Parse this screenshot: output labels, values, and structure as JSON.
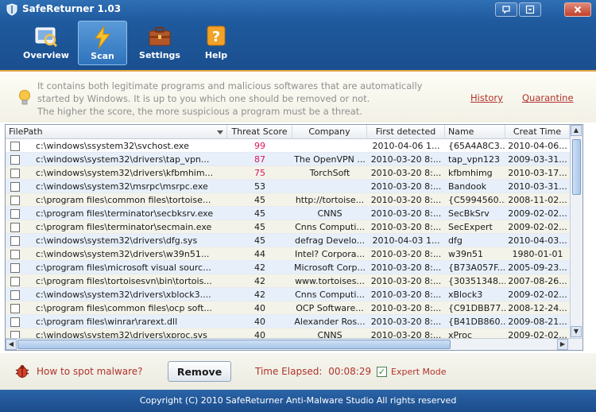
{
  "window": {
    "title": "SafeReturner 1.03",
    "controls": [
      "chat",
      "menu",
      "close"
    ]
  },
  "toolbar": {
    "items": [
      {
        "label": "Overview",
        "icon": "overview-icon"
      },
      {
        "label": "Scan",
        "icon": "scan-icon",
        "active": true
      },
      {
        "label": "Settings",
        "icon": "settings-icon"
      },
      {
        "label": "Help",
        "icon": "help-icon"
      }
    ]
  },
  "info": {
    "text_line1": "It contains both legitimate programs and malicious softwares that are automatically",
    "text_line2": "started by Windows. It is up to you which one should be removed or not.",
    "text_line3": "The higher the score, the more suspicious a program must be a threat.",
    "history_link": "History",
    "quarantine_link": "Quarantine"
  },
  "table": {
    "columns": [
      "FilePath",
      "Threat Score",
      "Company",
      "First detected",
      "Name",
      "Creat Time"
    ],
    "rows": [
      {
        "path": "c:\\windows\\ssystem32\\svchost.exe",
        "score": "99",
        "company": "",
        "first": "2010-04-06 1...",
        "name": "{65A4A8C3...",
        "created": "2010-04-06..."
      },
      {
        "path": "c:\\windows\\system32\\drivers\\tap_vpn...",
        "score": "87",
        "company": "The OpenVPN ...",
        "first": "2010-03-20 8:...",
        "name": "tap_vpn123",
        "created": "2009-03-31..."
      },
      {
        "path": "c:\\windows\\system32\\drivers\\kfbmhim...",
        "score": "75",
        "company": "TorchSoft",
        "first": "2010-03-20 8:...",
        "name": "kfbmhimg",
        "created": "2010-03-17..."
      },
      {
        "path": "c:\\windows\\system32\\msrpc\\msrpc.exe",
        "score": "53",
        "company": "",
        "first": "2010-03-20 8:...",
        "name": "Bandook",
        "created": "2010-03-31..."
      },
      {
        "path": "c:\\program files\\common files\\tortoise...",
        "score": "45",
        "company": "http://tortoise...",
        "first": "2010-03-20 8:...",
        "name": "{C5994560...",
        "created": "2008-11-02..."
      },
      {
        "path": "c:\\program files\\terminator\\secbksrv.exe",
        "score": "45",
        "company": "CNNS",
        "first": "2010-03-20 8:...",
        "name": "SecBkSrv",
        "created": "2009-02-02..."
      },
      {
        "path": "c:\\program files\\terminator\\secmain.exe",
        "score": "45",
        "company": "Cnns Computi...",
        "first": "2010-03-20 8:...",
        "name": "SecExpert",
        "created": "2009-02-02..."
      },
      {
        "path": "c:\\windows\\system32\\drivers\\dfg.sys",
        "score": "45",
        "company": "defrag Develo...",
        "first": "2010-04-03 1...",
        "name": "dfg",
        "created": "2010-04-03..."
      },
      {
        "path": "c:\\windows\\system32\\drivers\\w39n51...",
        "score": "44",
        "company": "Intel? Corpora...",
        "first": "2010-03-20 8:...",
        "name": "w39n51",
        "created": "1980-01-01"
      },
      {
        "path": "c:\\program files\\microsoft visual sourc...",
        "score": "42",
        "company": "Microsoft Corp...",
        "first": "2010-03-20 8:...",
        "name": "{B73A057F...",
        "created": "2005-09-23..."
      },
      {
        "path": "c:\\program files\\tortoisesvn\\bin\\tortois...",
        "score": "42",
        "company": "www.tortoises...",
        "first": "2010-03-20 8:...",
        "name": "{30351348...",
        "created": "2007-08-26..."
      },
      {
        "path": "c:\\windows\\system32\\drivers\\xblock3....",
        "score": "42",
        "company": "Cnns Computi...",
        "first": "2010-03-20 8:...",
        "name": "xBlock3",
        "created": "2009-02-02..."
      },
      {
        "path": "c:\\program files\\common files\\ocp soft...",
        "score": "40",
        "company": "OCP Software...",
        "first": "2010-03-20 8:...",
        "name": "{C91DBB77...",
        "created": "2008-12-24..."
      },
      {
        "path": "c:\\program files\\winrar\\rarext.dll",
        "score": "40",
        "company": "Alexander Ros...",
        "first": "2010-03-20 8:...",
        "name": "{B41DB860...",
        "created": "2009-08-21..."
      },
      {
        "path": "c:\\windows\\system32\\drivers\\xproc.sys",
        "score": "40",
        "company": "CNNS",
        "first": "2010-03-20 8:...",
        "name": "xProc",
        "created": "2009-02-02..."
      }
    ]
  },
  "actions": {
    "spot_link": "How to spot malware?",
    "remove_label": "Remove",
    "elapsed_label": "Time Elapsed:",
    "elapsed_value": "00:08:29",
    "expert_label": "Expert Mode",
    "expert_checked": true
  },
  "footer": {
    "text": "Copyright (C) 2010 SafeReturner Anti-Malware Studio All rights reserved"
  },
  "colors": {
    "accent_blue": "#1f5a9e",
    "link_red": "#b0322a",
    "high_score": "#d8175a",
    "info_border": "#e3a44a"
  }
}
